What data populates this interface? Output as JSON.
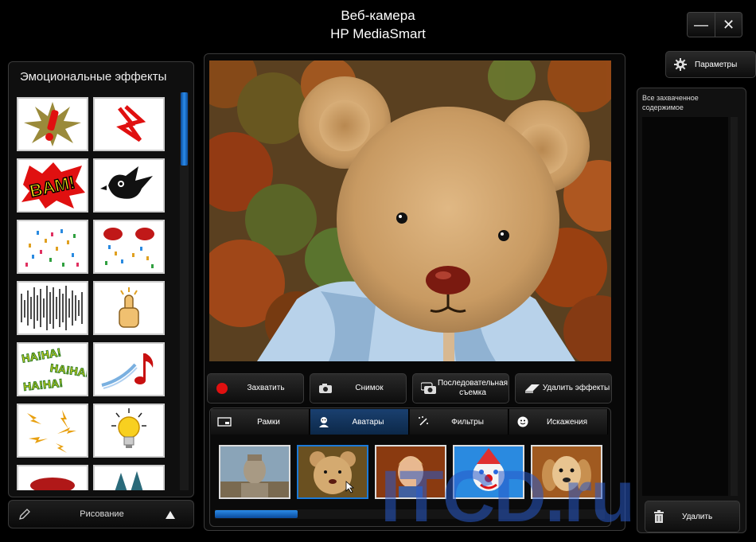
{
  "window": {
    "title": "Веб-камера",
    "subtitle": "HP MediaSmart",
    "minimize_glyph": "—",
    "close_glyph": "✕"
  },
  "left_panel": {
    "title": "Эмоциональные эффекты",
    "effects": [
      {
        "icon": "exclamation-burst-icon"
      },
      {
        "icon": "red-zigzag-icon"
      },
      {
        "icon": "bam-icon",
        "text": "BAM!"
      },
      {
        "icon": "bird-icon"
      },
      {
        "icon": "confetti-icon"
      },
      {
        "icon": "lips-confetti-icon"
      },
      {
        "icon": "static-lines-icon"
      },
      {
        "icon": "thumbs-up-icon"
      },
      {
        "icon": "haha-icon",
        "text": "HA!HA!"
      },
      {
        "icon": "music-note-icon"
      },
      {
        "icon": "lightning-bolts-icon"
      },
      {
        "icon": "light-bulb-icon"
      },
      {
        "icon": "red-lips-icon"
      },
      {
        "icon": "trees-icon"
      }
    ]
  },
  "drawing_bar": {
    "label": "Рисование"
  },
  "actions": {
    "capture": "Захватить",
    "snapshot": "Снимок",
    "burst_line1": "Последовательная",
    "burst_line2": "съемка",
    "remove_effects": "Удалить эффекты"
  },
  "tabs": [
    {
      "label": "Рамки",
      "icon": "frame-icon",
      "active": false
    },
    {
      "label": "Аватары",
      "icon": "avatar-icon",
      "active": true
    },
    {
      "label": "Фильтры",
      "icon": "magic-wand-icon",
      "active": false
    },
    {
      "label": "Искажения",
      "icon": "smiley-icon",
      "active": false
    }
  ],
  "avatars": [
    {
      "name": "terracotta-warrior",
      "selected": false
    },
    {
      "name": "teddy-bear",
      "selected": true
    },
    {
      "name": "blond-man",
      "selected": false
    },
    {
      "name": "clown",
      "selected": false
    },
    {
      "name": "dog",
      "selected": false
    }
  ],
  "right_panel": {
    "params_label": "Параметры",
    "captured_title": "Все захваченное содержимое",
    "delete_label": "Удалить"
  },
  "watermark": "ITCD.ru",
  "colors": {
    "accent": "#1c7ad8",
    "record": "#e01010",
    "background": "#000000"
  }
}
